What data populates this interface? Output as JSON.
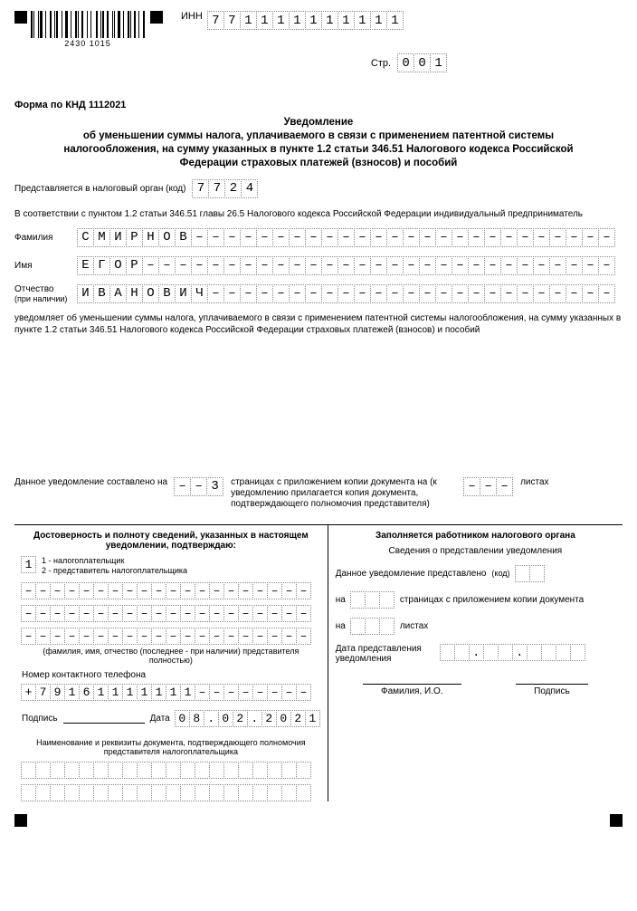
{
  "barcode_nums": "2430   1015",
  "inn_label": "ИНН",
  "inn": [
    "7",
    "7",
    "1",
    "1",
    "1",
    "1",
    "1",
    "1",
    "1",
    "1",
    "1",
    "1"
  ],
  "page_label": "Стр.",
  "page": [
    "0",
    "0",
    "1"
  ],
  "form_code": "Форма по КНД 1112021",
  "title_l1": "Уведомление",
  "title_l2": "об уменьшении суммы налога, уплачиваемого в связи с применением патентной системы",
  "title_l3": "налогообложения, на сумму указанных в пункте 1.2 статьи 346.51 Налогового кодекса Российской",
  "title_l4": "Федерации страховых платежей (взносов) и пособий",
  "tax_org_label": "Представляется в налоговый орган (код)",
  "tax_org": [
    "7",
    "7",
    "2",
    "4"
  ],
  "intro": "В соответствии с пунктом 1.2 статьи 346.51 главы 26.5 Налогового кодекса Российской Федерации индивидуальный предприниматель",
  "lbl_fam": "Фамилия",
  "lbl_name": "Имя",
  "lbl_patr": "Отчество",
  "lbl_patr_sub": "(при наличии)",
  "fam": [
    "С",
    "М",
    "И",
    "Р",
    "Н",
    "О",
    "В"
  ],
  "name": [
    "Е",
    "Г",
    "О",
    "Р"
  ],
  "patr": [
    "И",
    "В",
    "А",
    "Н",
    "О",
    "В",
    "И",
    "Ч"
  ],
  "notice": "уведомляет об уменьшении суммы налога, уплачиваемого в связи с применением патентной системы налогообложения, на сумму указанных в пункте 1.2 статьи 346.51 Налогового кодекса Российской Федерации страховых платежей (взносов) и пособий",
  "pages_label": "Данное уведомление составлено на",
  "pages_val": [
    "–",
    "–",
    "3"
  ],
  "pages_text": "страницах с приложением копии документа на (к уведомлению прилагается копия документа, подтверждающего полномочия представителя)",
  "sheets_val": [
    "–",
    "–",
    "–"
  ],
  "sheets_label": "листах",
  "left_head": "Достоверность и полноту сведений, указанных в настоящем уведомлении, подтверждаю:",
  "confirm_val": "1",
  "confirm_opts": "1 - налогоплательщик\n2 - представитель налогоплательщика",
  "rep_note": "(фамилия, имя, отчество (последнее - при наличии) представителя полностью)",
  "phone_label": "Номер контактного телефона",
  "phone": [
    "+",
    "7",
    "9",
    "1",
    "6",
    "1",
    "1",
    "1",
    "1",
    "1",
    "1",
    "1",
    "–",
    "–",
    "–",
    "–",
    "–",
    "–",
    "–",
    "–"
  ],
  "sign_label": "Подпись",
  "date_label": "Дата",
  "date": [
    "0",
    "8",
    ".",
    "0",
    "2",
    ".",
    "2",
    "0",
    "2",
    "1"
  ],
  "doc_head": "Наименование и реквизиты документа, подтверждающего полномочия представителя налогоплательщика",
  "right_head": "Заполняется работником налогового органа",
  "right_sub": "Сведения о представлении уведомления",
  "right_l1": "Данное уведомление представлено",
  "right_code": "(код)",
  "right_l2a": "на",
  "right_l2b": "страницах с приложением копии документа",
  "right_l3b": "листах",
  "right_l4": "Дата представления уведомления",
  "fio": "Фамилия, И.О.",
  "sign": "Подпись"
}
